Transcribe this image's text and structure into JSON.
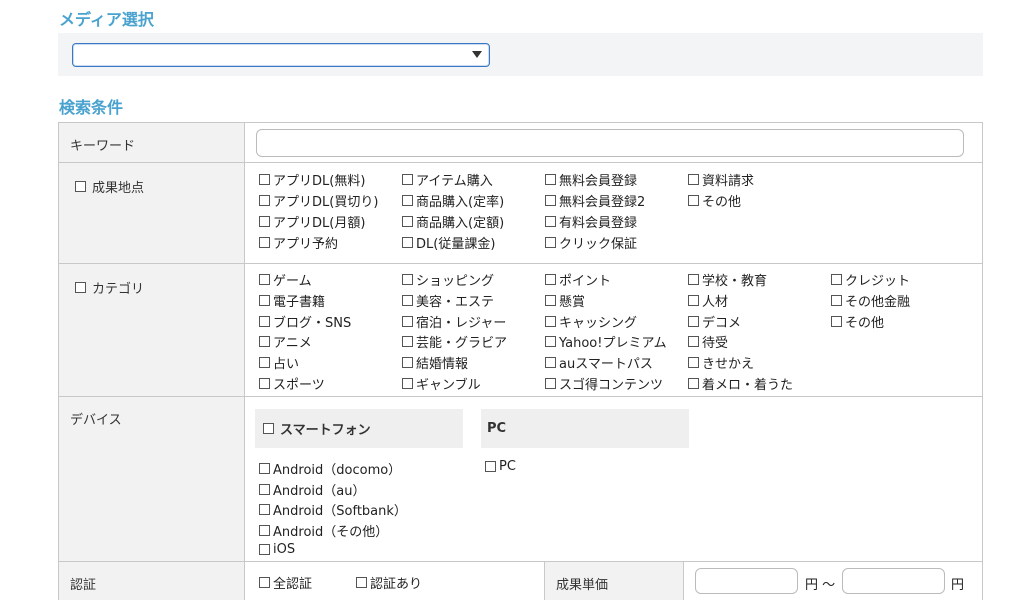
{
  "media": {
    "title": "メディア選択",
    "select_value": ""
  },
  "search": {
    "title": "検索条件",
    "keyword": {
      "label": "キーワード",
      "value": ""
    },
    "result_point": {
      "label": "成果地点",
      "options": [
        "アプリDL(無料)",
        "アプリDL(買切り)",
        "アプリDL(月額)",
        "アプリ予約",
        "アイテム購入",
        "商品購入(定率)",
        "商品購入(定額)",
        "DL(従量課金)",
        "無料会員登録",
        "無料会員登録2",
        "有料会員登録",
        "クリック保証",
        "資料請求",
        "その他"
      ]
    },
    "category": {
      "label": "カテゴリ",
      "options": [
        "ゲーム",
        "電子書籍",
        "ブログ・SNS",
        "アニメ",
        "占い",
        "スポーツ",
        "ショッピング",
        "美容・エステ",
        "宿泊・レジャー",
        "芸能・グラビア",
        "結婚情報",
        "ギャンブル",
        "ポイント",
        "懸賞",
        "キャッシング",
        "Yahoo!プレミアム",
        "auスマートパス",
        "スゴ得コンテンツ",
        "学校・教育",
        "人材",
        "デコメ",
        "待受",
        "きせかえ",
        "着メロ・着うた",
        "クレジット",
        "その他金融",
        "その他"
      ]
    },
    "device": {
      "label": "デバイス",
      "smartphone": {
        "header": "スマートフォン",
        "options": [
          "Android（docomo）",
          "Android（au）",
          "Android（Softbank）",
          "Android（その他）",
          "iOS"
        ]
      },
      "pc": {
        "header": "PC",
        "options": [
          "PC"
        ]
      }
    },
    "auth": {
      "label": "認証",
      "options": [
        "全認証",
        "認証あり"
      ],
      "unit_price_label": "成果単価",
      "min_value": "",
      "max_value": "",
      "yen": "円",
      "tilde": "円 〜"
    }
  }
}
